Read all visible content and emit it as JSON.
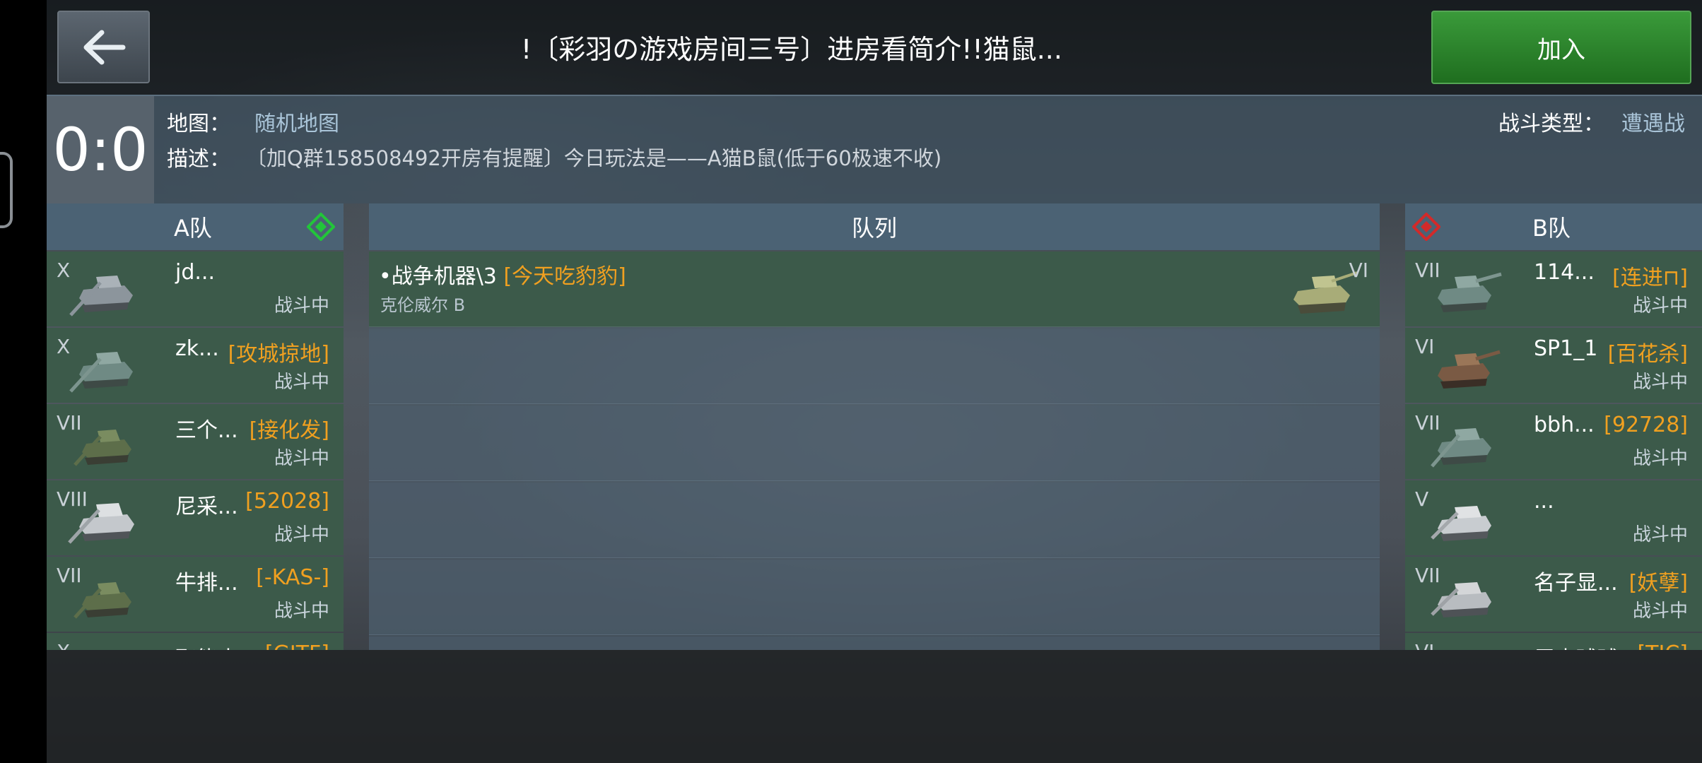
{
  "header": {
    "title": "!〔彩羽の游戏房间三号〕进房看简介!!猫鼠...",
    "join_label": "加入"
  },
  "info": {
    "score": "0:0",
    "map_label": "地图：",
    "map_value": "随机地图",
    "desc_label": "描述：",
    "desc_value": "〔加Q群158508492开房有提醒〕今日玩法是——A猫B鼠(低于60极速不收)",
    "battle_type_label": "战斗类型：",
    "battle_type_value": "遭遇战"
  },
  "team_a": {
    "title": "A队",
    "players": [
      {
        "tier": "X",
        "name": "jd...",
        "clan": "",
        "status": "战斗中"
      },
      {
        "tier": "X",
        "name": "zk...",
        "clan": "[攻城掠地]",
        "status": "战斗中"
      },
      {
        "tier": "VII",
        "name": "三个...",
        "clan": "[接化发]",
        "status": "战斗中"
      },
      {
        "tier": "VIII",
        "name": "尼采...",
        "clan": "[52028]",
        "status": "战斗中"
      },
      {
        "tier": "VII",
        "name": "牛排...",
        "clan": "[-KAS-]",
        "status": "战斗中"
      },
      {
        "tier": "X",
        "name": "聚能中...",
        "clan": "[GJTF]",
        "status": ""
      }
    ]
  },
  "queue": {
    "title": "队列",
    "entry": {
      "bullet": "•",
      "name": "战争机器\\3",
      "clan": "[今天吃豹豹]",
      "tank": "克伦威尔 B",
      "tier": "VI"
    }
  },
  "team_b": {
    "title": "B队",
    "players": [
      {
        "tier": "VII",
        "name": "114...",
        "clan": "[连进⊓]",
        "status": "战斗中"
      },
      {
        "tier": "VI",
        "name": "SP1_1",
        "clan": "[百花杀]",
        "status": "战斗中"
      },
      {
        "tier": "VII",
        "name": "bbh...",
        "clan": "[92728]",
        "status": "战斗中"
      },
      {
        "tier": "V",
        "name": "...",
        "clan": "",
        "status": "战斗中"
      },
      {
        "tier": "VII",
        "name": "名子显...",
        "clan": "[妖孽]",
        "status": "战斗中"
      },
      {
        "tier": "VI",
        "name": "屋内球球",
        "clan": "[TIC]",
        "status": ""
      }
    ]
  },
  "colors": {
    "join_green": "#2a8a2a",
    "clan_orange": "#f0a020",
    "team_a_marker": "#22c53a",
    "team_b_marker": "#d22a2a"
  },
  "icons": {
    "back": "back-arrow-icon",
    "team_a": "green-diamond-icon",
    "team_b": "red-diamond-icon",
    "tank": "tank-icon"
  }
}
